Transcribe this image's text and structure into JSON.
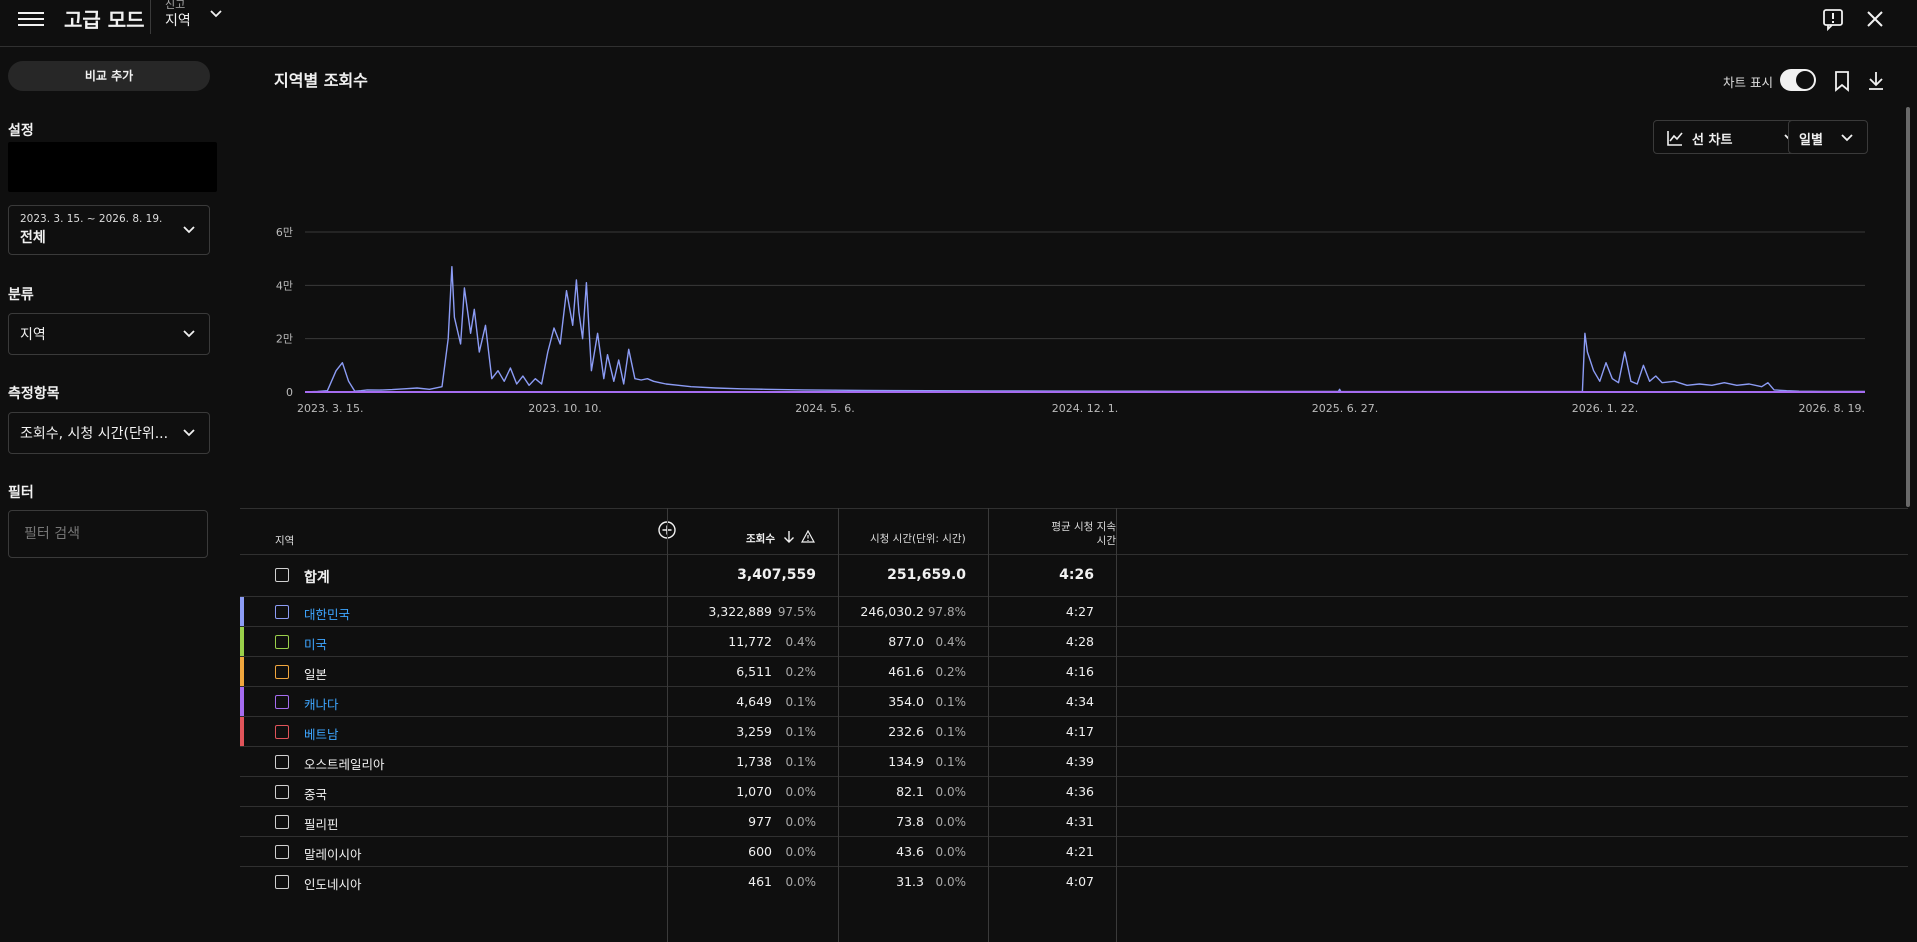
{
  "topbar": {
    "title": "고급 모드",
    "crumb_small": "신고",
    "crumb_big": "지역"
  },
  "sidebar": {
    "compare_button": "비교 추가",
    "settings_label": "설정",
    "date_range": "2023. 3. 15. ~ 2026. 8. 19.",
    "date_preset": "전체",
    "breakdown_label": "분류",
    "breakdown_value": "지역",
    "metrics_label": "측정항목",
    "metrics_value": "조회수, 시청 시간(단위...",
    "filter_label": "필터",
    "filter_placeholder": "필터 검색"
  },
  "main": {
    "title": "지역별 조회수",
    "toggle_label": "차트 표시",
    "chart_type_label": "선 차트",
    "interval_label": "일별"
  },
  "chart_data": {
    "type": "line",
    "x_tick_labels": [
      "2023. 3. 15.",
      "2023. 10. 10.",
      "2024. 5. 6.",
      "2024. 12. 1.",
      "2025. 6. 27.",
      "2026. 1. 22.",
      "2026. 8. 19."
    ],
    "y_tick_labels": [
      "0",
      "2만",
      "4만",
      "6만"
    ],
    "ylim": [
      0,
      60000
    ],
    "grid": true,
    "series": [
      {
        "name": "대한민국",
        "color": "#8c9cf5",
        "x": [
          0,
          10,
          18,
          25,
          30,
          35,
          40,
          45,
          50,
          60,
          70,
          80,
          90,
          100,
          110,
          115,
          118,
          120,
          125,
          128,
          133,
          136,
          140,
          145,
          150,
          155,
          160,
          165,
          170,
          175,
          180,
          185,
          190,
          195,
          200,
          205,
          210,
          215,
          218,
          220,
          223,
          226,
          230,
          235,
          240,
          243,
          248,
          252,
          256,
          260,
          265,
          270,
          275,
          280,
          285,
          290,
          300,
          310,
          330,
          350,
          370,
          400,
          450,
          500,
          550,
          600,
          650,
          700,
          750,
          800,
          830,
          831,
          832,
          850,
          900,
          950,
          1000,
          1026,
          1028,
          1030,
          1035,
          1040,
          1045,
          1050,
          1055,
          1060,
          1065,
          1070,
          1075,
          1080,
          1085,
          1090,
          1100,
          1110,
          1120,
          1130,
          1140,
          1150,
          1160,
          1170,
          1175,
          1180,
          1190,
          1200,
          1220,
          1253
        ],
        "y": [
          0,
          200,
          500,
          8000,
          11000,
          4000,
          300,
          500,
          800,
          700,
          900,
          1200,
          1500,
          1000,
          2000,
          20000,
          47000,
          28000,
          18000,
          39000,
          22000,
          31000,
          15000,
          25000,
          5000,
          8000,
          4000,
          9000,
          3000,
          6000,
          2500,
          5000,
          3000,
          15000,
          24000,
          18000,
          38000,
          25000,
          42000,
          30000,
          20000,
          41000,
          8000,
          22000,
          5000,
          14000,
          4000,
          12000,
          3000,
          16000,
          5000,
          4500,
          5000,
          4000,
          3500,
          3000,
          2500,
          2000,
          1500,
          1200,
          1000,
          800,
          600,
          500,
          400,
          350,
          300,
          250,
          250,
          200,
          200,
          1000,
          200,
          150,
          150,
          150,
          150,
          150,
          22000,
          15000,
          8000,
          4000,
          11000,
          5000,
          3500,
          15000,
          4000,
          3000,
          10000,
          4000,
          6000,
          3500,
          4000,
          2500,
          3000,
          2500,
          3500,
          2500,
          3000,
          2000,
          3500,
          800,
          500,
          300,
          200,
          200
        ]
      },
      {
        "name": "캐나다",
        "color": "#a56cf0",
        "x": [
          0,
          1253
        ],
        "y": [
          0,
          0
        ]
      }
    ]
  },
  "table": {
    "headers": {
      "region": "지역",
      "views": "조회수",
      "watch_time": "시청 시간(단위: 시간)",
      "avg_duration_1": "평균 시청 지속",
      "avg_duration_2": "시간"
    },
    "total": {
      "name": "합계",
      "views": "3,407,559",
      "watch": "251,659.0",
      "avg": "4:26"
    },
    "rows": [
      {
        "name": "대한민국",
        "views": "3,322,889",
        "views_pct": "97.5%",
        "watch": "246,030.2",
        "watch_pct": "97.8%",
        "avg": "4:27",
        "color": "#8c9cf5",
        "selected": true
      },
      {
        "name": "미국",
        "views": "11,772",
        "views_pct": "0.4%",
        "watch": "877.0",
        "watch_pct": "0.4%",
        "avg": "4:28",
        "color": "#9ad04a",
        "selected": true
      },
      {
        "name": "일본",
        "views": "6,511",
        "views_pct": "0.2%",
        "watch": "461.6",
        "watch_pct": "0.2%",
        "avg": "4:16",
        "color": "#f0a63d",
        "selected": false
      },
      {
        "name": "캐나다",
        "views": "4,649",
        "views_pct": "0.1%",
        "watch": "354.0",
        "watch_pct": "0.1%",
        "avg": "4:34",
        "color": "#a56cf0",
        "selected": true
      },
      {
        "name": "베트남",
        "views": "3,259",
        "views_pct": "0.1%",
        "watch": "232.6",
        "watch_pct": "0.1%",
        "avg": "4:17",
        "color": "#e0545a",
        "selected": true
      },
      {
        "name": "오스트레일리아",
        "views": "1,738",
        "views_pct": "0.1%",
        "watch": "134.9",
        "watch_pct": "0.1%",
        "avg": "4:39",
        "color": "",
        "selected": false
      },
      {
        "name": "중국",
        "views": "1,070",
        "views_pct": "0.0%",
        "watch": "82.1",
        "watch_pct": "0.0%",
        "avg": "4:36",
        "color": "",
        "selected": false
      },
      {
        "name": "필리핀",
        "views": "977",
        "views_pct": "0.0%",
        "watch": "73.8",
        "watch_pct": "0.0%",
        "avg": "4:31",
        "color": "",
        "selected": false
      },
      {
        "name": "말레이시아",
        "views": "600",
        "views_pct": "0.0%",
        "watch": "43.6",
        "watch_pct": "0.0%",
        "avg": "4:21",
        "color": "",
        "selected": false
      },
      {
        "name": "인도네시아",
        "views": "461",
        "views_pct": "0.0%",
        "watch": "31.3",
        "watch_pct": "0.0%",
        "avg": "4:07",
        "color": "",
        "selected": false
      }
    ]
  }
}
